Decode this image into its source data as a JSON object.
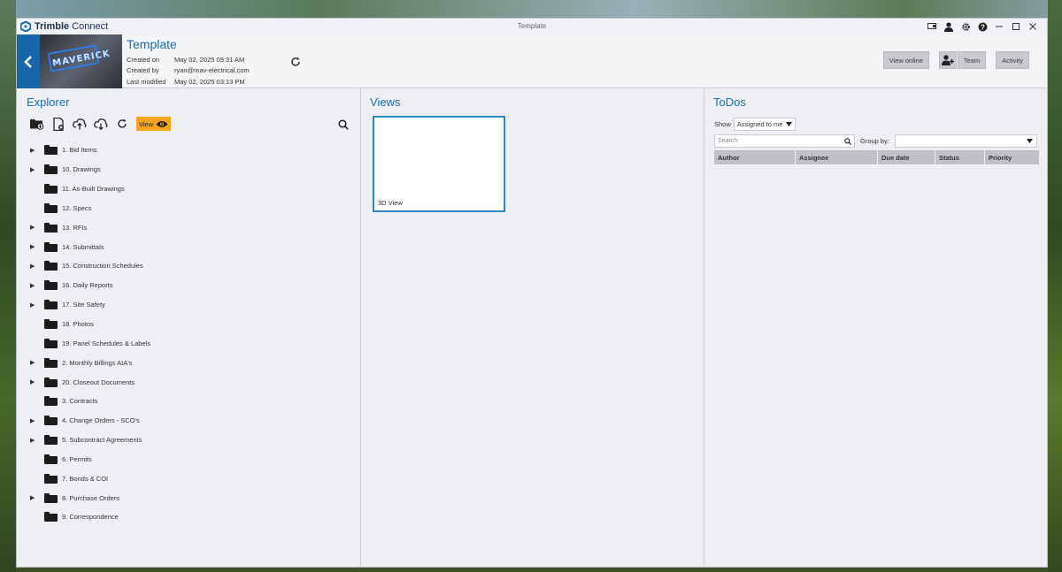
{
  "app": {
    "brand_bold": "Trimble",
    "brand_rest": " Connect",
    "window_title": "Template"
  },
  "header": {
    "project_title": "Template",
    "meta": [
      {
        "label": "Created on",
        "value": "May 02, 2025 09:31 AM"
      },
      {
        "label": "Created by",
        "value": "ryan@mav-electrical.com"
      },
      {
        "label": "Last modified",
        "value": "May 02, 2025 03:13 PM"
      }
    ],
    "thumbnail_text": "MAVERICK",
    "view_online_label": "View online",
    "team_label": "Team",
    "activity_label": "Activity"
  },
  "explorer": {
    "title": "Explorer",
    "view_label": "View",
    "folders": [
      {
        "name": "1. Bid Items",
        "expandable": true
      },
      {
        "name": "10. Drawings",
        "expandable": true
      },
      {
        "name": "11. As-Built Drawings",
        "expandable": false
      },
      {
        "name": "12. Specs",
        "expandable": false
      },
      {
        "name": "13. RFIs",
        "expandable": true
      },
      {
        "name": "14. Submittals",
        "expandable": true
      },
      {
        "name": "15. Construction Schedules",
        "expandable": true
      },
      {
        "name": "16. Daily Reports",
        "expandable": true
      },
      {
        "name": "17. Site Safety",
        "expandable": true
      },
      {
        "name": "18. Photos",
        "expandable": false
      },
      {
        "name": "19. Panel Schedules & Labels",
        "expandable": false
      },
      {
        "name": "2. Monthly Billings AIA's",
        "expandable": true
      },
      {
        "name": "20. Closeout Documents",
        "expandable": true
      },
      {
        "name": "3. Contracts",
        "expandable": false
      },
      {
        "name": "4. Change Orders - SCO's",
        "expandable": true
      },
      {
        "name": "5. Subcontract Agreements",
        "expandable": true
      },
      {
        "name": "6. Permits",
        "expandable": false
      },
      {
        "name": "7. Bonds & COI",
        "expandable": false
      },
      {
        "name": "8. Purchase Orders",
        "expandable": true
      },
      {
        "name": "9. Correspondence",
        "expandable": false
      }
    ]
  },
  "views": {
    "title": "Views",
    "cards": [
      {
        "label": "3D View"
      }
    ]
  },
  "todos": {
    "title": "ToDos",
    "show_label": "Show",
    "show_value": "Assigned to me",
    "search_placeholder": "Search",
    "group_by_label": "Group by:",
    "group_by_value": "",
    "columns": [
      "Author",
      "Assignee",
      "Due date",
      "Status",
      "Priority"
    ]
  },
  "colors": {
    "accent": "#1b6fa8",
    "back_button": "#1766a8",
    "view_button": "#f5a21e"
  }
}
